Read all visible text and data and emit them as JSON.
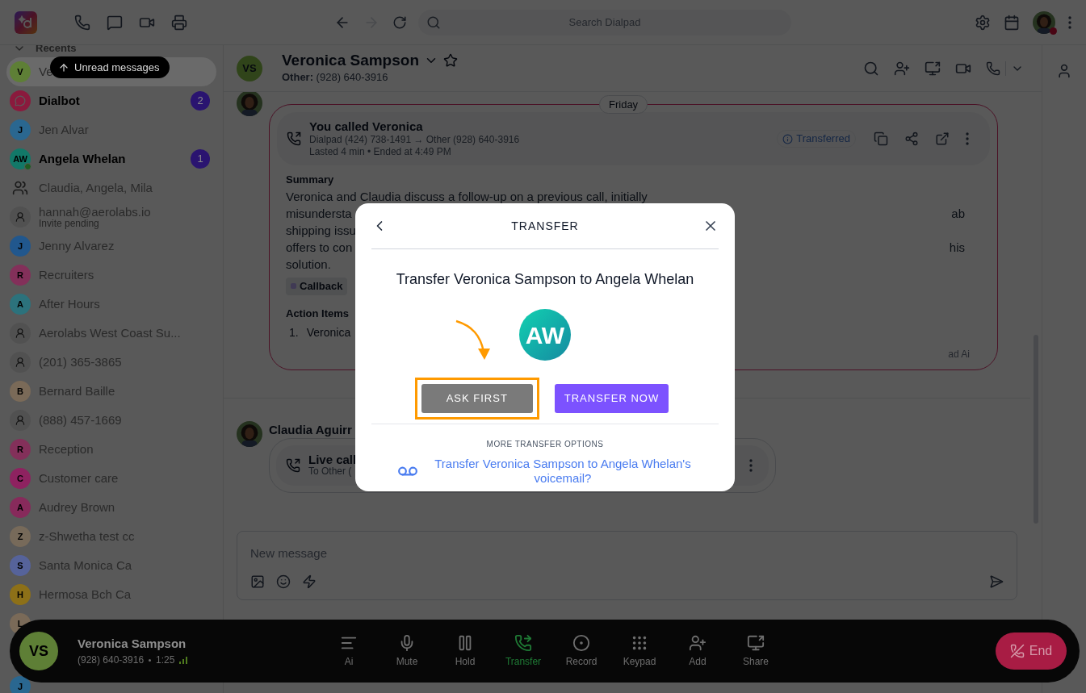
{
  "topbar": {
    "back": {
      "disabled": false
    },
    "forward": {
      "disabled": true
    },
    "search": {
      "placeholder": "Search Dialpad"
    }
  },
  "sidebar": {
    "section": "Recents",
    "unread_pill": "Unread messages",
    "items": [
      {
        "kind": "initial",
        "initial": "V",
        "name": "Ve",
        "color": "#5e7f36",
        "selected": true,
        "unread": false
      },
      {
        "kind": "bot",
        "name": "Dialbot",
        "color": "#8a1a3d",
        "selected": false,
        "unread": true,
        "count": "2"
      },
      {
        "kind": "initial",
        "initial": "J",
        "name": "Jen Alvar",
        "color": "#2a6790",
        "selected": false,
        "unread": false
      },
      {
        "kind": "initial",
        "initial": "AW",
        "name": "Angela Whelan",
        "color": "#127868",
        "selected": false,
        "unread": true,
        "count": "1",
        "online": true
      },
      {
        "kind": "group",
        "name": "Claudia, Angela, Mila",
        "selected": false,
        "unread": false
      },
      {
        "kind": "person",
        "name": "hannah@aerolabs.io",
        "subtitle": "Invite pending",
        "selected": false,
        "unread": false
      },
      {
        "kind": "initial",
        "initial": "J",
        "name": "Jenny Alvarez",
        "color": "#21578d",
        "selected": false,
        "unread": false
      },
      {
        "kind": "initial",
        "initial": "R",
        "name": "Recruiters",
        "color": "#83305a",
        "selected": false,
        "unread": false
      },
      {
        "kind": "initial",
        "initial": "A",
        "name": "After Hours",
        "color": "#2c727c",
        "selected": false,
        "unread": false
      },
      {
        "kind": "person",
        "name": "Aerolabs West Coast Su...",
        "selected": false,
        "unread": false
      },
      {
        "kind": "person",
        "name": "(201) 365-3865",
        "selected": false,
        "unread": false
      },
      {
        "kind": "initial",
        "initial": "B",
        "name": "Bernard Baille",
        "color": "#7a6a58",
        "selected": false,
        "unread": false
      },
      {
        "kind": "person",
        "name": "(888) 457-1669",
        "selected": false,
        "unread": false
      },
      {
        "kind": "initial",
        "initial": "R",
        "name": "Reception",
        "color": "#83305a",
        "selected": false,
        "unread": false
      },
      {
        "kind": "initial",
        "initial": "C",
        "name": "Customer care",
        "color": "#8e2260",
        "selected": false,
        "unread": false
      },
      {
        "kind": "initial",
        "initial": "A",
        "name": "Audrey Brown",
        "color": "#872a5b",
        "selected": false,
        "unread": false
      },
      {
        "kind": "initial",
        "initial": "Z",
        "name": "z-Shwetha test cc",
        "color": "#776a5a",
        "selected": false,
        "unread": false
      },
      {
        "kind": "initial",
        "initial": "S",
        "name": "Santa Monica Ca",
        "color": "#56639a",
        "selected": false,
        "unread": false
      },
      {
        "kind": "initial",
        "initial": "H",
        "name": "Hermosa Bch Ca",
        "color": "#8d7018",
        "selected": false,
        "unread": false
      },
      {
        "kind": "initial",
        "initial": "L",
        "color": "#7a6a58",
        "selected": false
      },
      {
        "kind": "initial",
        "initial": "J",
        "color": "#2a6790",
        "selected": false
      }
    ]
  },
  "conversation": {
    "initials": "VS",
    "name": "Veronica Sampson",
    "subtitle": "**Other:** (928) 640-3916",
    "call_card": {
      "date_chip": "Friday",
      "title": "You called Veronica",
      "route": "Dialpad (424) 738-1491 → Other (928) 640-3916",
      "meta": "Lasted 4 min • Ended at 4:49 PM",
      "status": "Transferred",
      "summary_title": "Summary",
      "summary_lines": [
        {
          "left": "Veronica and Claudia discuss a follow-up on a previous call, initially"
        },
        {
          "left": "misundersta",
          "right": "ab"
        },
        {
          "left": "shipping issu"
        },
        {
          "left": "offers to con",
          "right": "his"
        },
        {
          "left": "solution."
        }
      ],
      "tag": "Callback",
      "action_title": "Action Items",
      "action_items": [
        {
          "number": "1.",
          "text": "Veronica"
        }
      ],
      "footer": "ad Ai"
    },
    "live_message": {
      "sender": "Claudia Aguirr",
      "title": "Live call",
      "meta": "To Other ("
    },
    "composer": {
      "placeholder": "New message"
    }
  },
  "call_bar": {
    "initials": "VS",
    "name": "Veronica Sampson",
    "number": "(928) 640-3916",
    "timer": "1:25",
    "controls": [
      {
        "kind": "ai",
        "label": "Ai",
        "selected": false
      },
      {
        "kind": "mute",
        "label": "Mute",
        "selected": false
      },
      {
        "kind": "hold",
        "label": "Hold",
        "selected": false
      },
      {
        "kind": "transfer",
        "label": "Transfer",
        "selected": true
      },
      {
        "kind": "record",
        "label": "Record",
        "selected": false
      },
      {
        "kind": "keypad",
        "label": "Keypad",
        "selected": false
      },
      {
        "kind": "add",
        "label": "Add",
        "selected": false
      },
      {
        "kind": "share",
        "label": "Share",
        "selected": false
      }
    ],
    "end": "End"
  },
  "modal": {
    "title": "TRANSFER",
    "heading": "Transfer Veronica Sampson to Angela Whelan",
    "initials": "AW",
    "buttons": [
      {
        "kind": "secondary",
        "label": "ASK FIRST",
        "highlighted": true
      },
      {
        "kind": "primary",
        "label": "TRANSFER NOW",
        "highlighted": false
      }
    ],
    "more_label": "MORE TRANSFER OPTIONS",
    "voicemail_link": "Transfer Veronica Sampson to Angela Whelan's voicemail?"
  }
}
